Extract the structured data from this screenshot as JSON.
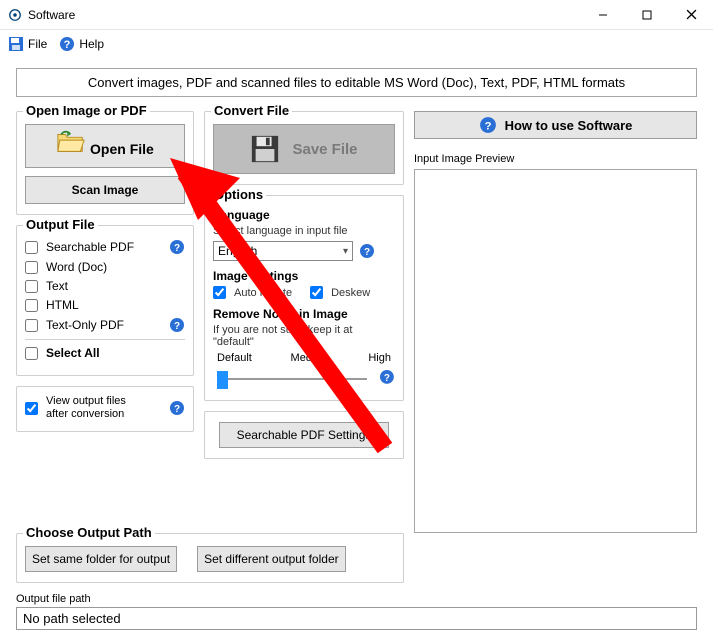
{
  "window": {
    "title": "Software"
  },
  "menu": {
    "file": "File",
    "help": "Help"
  },
  "banner": "Convert images, PDF and scanned files to editable MS Word (Doc), Text, PDF, HTML formats",
  "open_group": {
    "title": "Open Image or PDF",
    "open_file": "Open File",
    "scan_image": "Scan Image"
  },
  "convert_group": {
    "title": "Convert File",
    "save_file": "Save File"
  },
  "output_group": {
    "title": "Output File",
    "items": {
      "searchable_pdf": "Searchable PDF",
      "word": "Word (Doc)",
      "text": "Text",
      "html": "HTML",
      "textonly": "Text-Only PDF"
    },
    "select_all": "Select All"
  },
  "options_group": {
    "title": "Options",
    "language_title": "Language",
    "language_hint": "Select language in input file",
    "language_value": "English",
    "image_settings_title": "Image Settings",
    "auto_rotate": "Auto Rotate",
    "deskew": "Deskew",
    "noise_title": "Remove Noise in Image",
    "noise_hint": "If you are not sure, keep it at \"default\"",
    "slider": {
      "default": "Default",
      "medium": "Medium",
      "high": "High"
    },
    "searchable_pdf_settings": "Searchable PDF Settings"
  },
  "view_after": "View output files\nafter conversion",
  "choose_path": {
    "title": "Choose Output Path",
    "same": "Set same folder for output",
    "diff": "Set different output folder"
  },
  "outpath": {
    "title": "Output file path",
    "value": "No path selected"
  },
  "right": {
    "howto": "How to use Software",
    "preview_label": "Input Image Preview"
  }
}
